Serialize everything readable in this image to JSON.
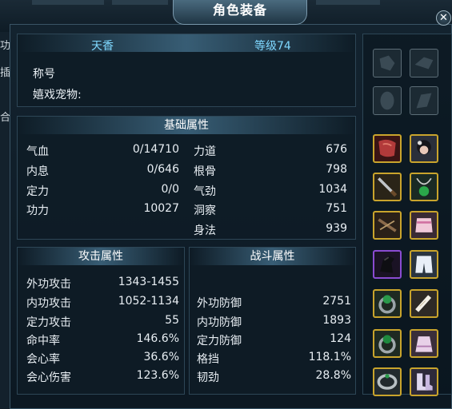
{
  "window": {
    "title": "角色装备",
    "close_label": "✕"
  },
  "background": {
    "left_marks": [
      "功",
      "插",
      "合"
    ]
  },
  "profile": {
    "name": "天香",
    "level": "等级74",
    "title_label": "称号",
    "pet_label": "嬉戏宠物:"
  },
  "basic": {
    "header": "基础属性",
    "left": [
      {
        "label": "气血",
        "value": "0/14710"
      },
      {
        "label": "内息",
        "value": "0/646"
      },
      {
        "label": "定力",
        "value": "0/0"
      },
      {
        "label": "功力",
        "value": "10027"
      }
    ],
    "right": [
      {
        "label": "力道",
        "value": "676"
      },
      {
        "label": "根骨",
        "value": "798"
      },
      {
        "label": "气劲",
        "value": "1034"
      },
      {
        "label": "洞察",
        "value": "751"
      },
      {
        "label": "身法",
        "value": "939"
      }
    ]
  },
  "attack": {
    "header": "攻击属性",
    "rows": [
      {
        "label": "外功攻击",
        "value": "1343-1455"
      },
      {
        "label": "内功攻击",
        "value": "1052-1134"
      },
      {
        "label": "定力攻击",
        "value": "55"
      },
      {
        "label": "命中率",
        "value": "146.6%"
      },
      {
        "label": "会心率",
        "value": "36.6%"
      },
      {
        "label": "会心伤害",
        "value": "123.6%"
      }
    ]
  },
  "defense": {
    "header": "战斗属性",
    "rows": [
      {
        "label": "外功防御",
        "value": "2751"
      },
      {
        "label": "内功防御",
        "value": "1893"
      },
      {
        "label": "定力防御",
        "value": "124"
      },
      {
        "label": "格挡",
        "value": "118.1%"
      },
      {
        "label": "韧劲",
        "value": "28.8%"
      }
    ]
  },
  "equipment_slots": [
    {
      "slot": "fashion-1",
      "icon": "empty-slot-icon",
      "filled": false
    },
    {
      "slot": "fashion-2",
      "icon": "empty-slot-icon",
      "filled": false
    },
    {
      "slot": "fashion-3",
      "icon": "empty-slot-icon",
      "filled": false
    },
    {
      "slot": "fashion-4",
      "icon": "empty-slot-icon",
      "filled": false
    },
    {
      "slot": "cape",
      "icon": "red-cape-icon",
      "filled": true
    },
    {
      "slot": "head",
      "icon": "hair-ornament-icon",
      "filled": true
    },
    {
      "slot": "weapon",
      "icon": "dagger-icon",
      "filled": true
    },
    {
      "slot": "necklace",
      "icon": "jade-necklace-icon",
      "filled": true
    },
    {
      "slot": "offhand",
      "icon": "crossbow-icon",
      "filled": true
    },
    {
      "slot": "chest",
      "icon": "pink-top-icon",
      "filled": true
    },
    {
      "slot": "mount",
      "icon": "black-horse-icon",
      "filled": true,
      "rarity": "purple"
    },
    {
      "slot": "legs",
      "icon": "white-pants-icon",
      "filled": true
    },
    {
      "slot": "ring-1",
      "icon": "jade-ring-icon",
      "filled": true
    },
    {
      "slot": "arms",
      "icon": "arm-wrap-icon",
      "filled": true
    },
    {
      "slot": "ring-2",
      "icon": "green-ring-icon",
      "filled": true
    },
    {
      "slot": "skirt",
      "icon": "skirt-icon",
      "filled": true
    },
    {
      "slot": "bracelet",
      "icon": "silver-bracelet-icon",
      "filled": true
    },
    {
      "slot": "boots",
      "icon": "boots-icon",
      "filled": true
    }
  ],
  "colors": {
    "accent_cyan": "#7fd8ff",
    "gold_border": "#c9a42c",
    "purple_border": "#8a4bd1"
  }
}
